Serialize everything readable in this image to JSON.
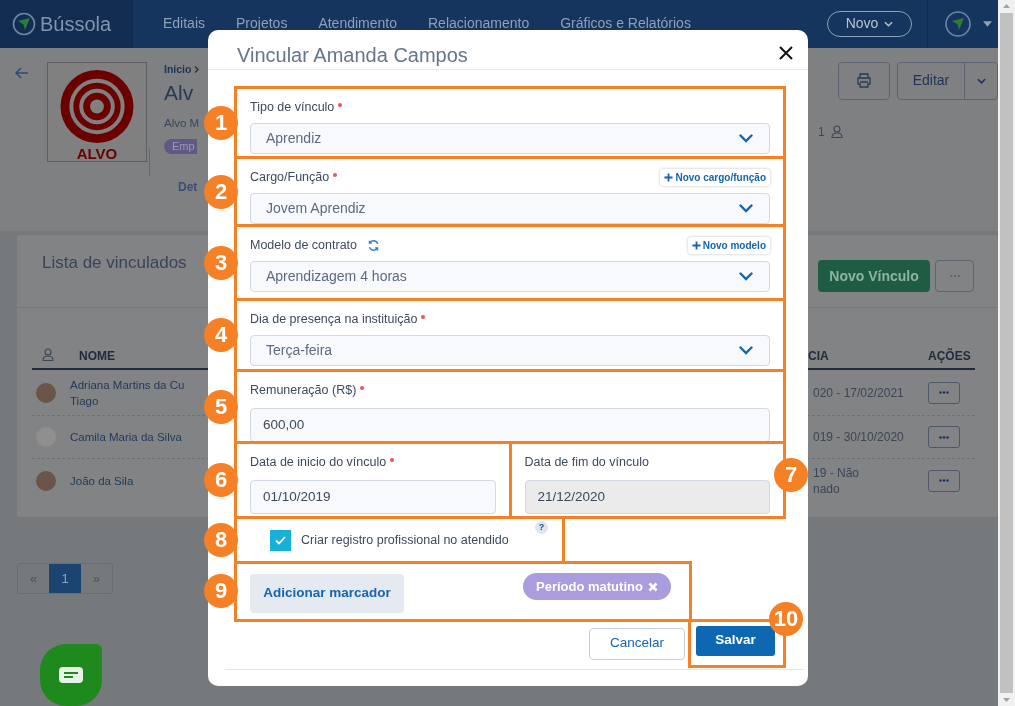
{
  "nav": {
    "brand": "Bússola",
    "items": [
      "Editais",
      "Projetos",
      "Atendimento",
      "Relacionamento",
      "Gráficos e Relatórios"
    ],
    "new_button": "Novo"
  },
  "profile": {
    "breadcrumb": "Início",
    "title": "Alv",
    "subtitle": "Alvo M",
    "badge": "Emp",
    "tab": "Det",
    "logo_text": "ALVO",
    "member_count": "1",
    "edit_button": "Editar"
  },
  "list": {
    "title": "Lista de vinculados",
    "new_button": "Novo Vínculo",
    "name_header": "NOME",
    "period_header": "CIA",
    "actions_header": "AÇÕES",
    "rows": [
      {
        "name": [
          "Adriana Martins da Cu",
          "Tiago"
        ],
        "period": [
          "020 - 17/02/2021"
        ],
        "kind": "photo"
      },
      {
        "name": [
          "Camila Maria da Silva"
        ],
        "period": [
          "019 - 30/10/2020"
        ],
        "kind": "placeholder"
      },
      {
        "name": [
          "João da Sila"
        ],
        "period": [
          "19 - Não",
          "nado"
        ],
        "kind": "photo"
      }
    ],
    "pagination": [
      {
        "label": "«",
        "selected": false
      },
      {
        "label": "1",
        "selected": true
      },
      {
        "label": "»",
        "selected": false
      }
    ]
  },
  "modal": {
    "title": "Vincular Amanda Campos",
    "sections": [
      {
        "fields": [
          {
            "callout": "1",
            "kind": "select",
            "label": "Tipo de vínculo",
            "required": true,
            "value": "Aprendiz"
          }
        ]
      },
      {
        "fields": [
          {
            "callout": "2",
            "kind": "select",
            "label": "Cargo/Função",
            "required": true,
            "value": "Jovem Aprendiz",
            "add_button": "Novo cargo/função"
          }
        ]
      },
      {
        "fields": [
          {
            "callout": "3",
            "kind": "select",
            "label": "Modelo de contrato",
            "required": false,
            "refresh": true,
            "value": "Aprendizagem 4 horas",
            "add_button": "Novo modelo"
          }
        ]
      },
      {
        "fields": [
          {
            "callout": "4",
            "kind": "select",
            "label": "Dia de presença na instituição",
            "required": true,
            "value": "Terça-feira"
          }
        ]
      },
      {
        "fields": [
          {
            "callout": "5",
            "kind": "input",
            "label": "Remuneração (R$)",
            "required": true,
            "value": "600,00"
          }
        ]
      },
      {
        "fields": [
          {
            "callout": "6",
            "kind": "input",
            "label": "Data de inicio do vínculo",
            "required": true,
            "value": "01/10/2019",
            "disabled": false
          },
          {
            "callout": "7",
            "kind": "input",
            "label": "Data de fim do vínculo",
            "required": false,
            "value": "21/12/2020",
            "disabled": true
          }
        ]
      }
    ],
    "checkbox": {
      "callout": "8",
      "label": "Criar registro profissional no atendido",
      "checked": true,
      "help": "?"
    },
    "tags": {
      "callout": "9",
      "button": "Adicionar marcador",
      "items": [
        {
          "label": "Período matutino",
          "color": "#ab9ddd"
        }
      ]
    },
    "footer": {
      "callout": "10",
      "cancel": "Cancelar",
      "save": "Salvar"
    }
  }
}
